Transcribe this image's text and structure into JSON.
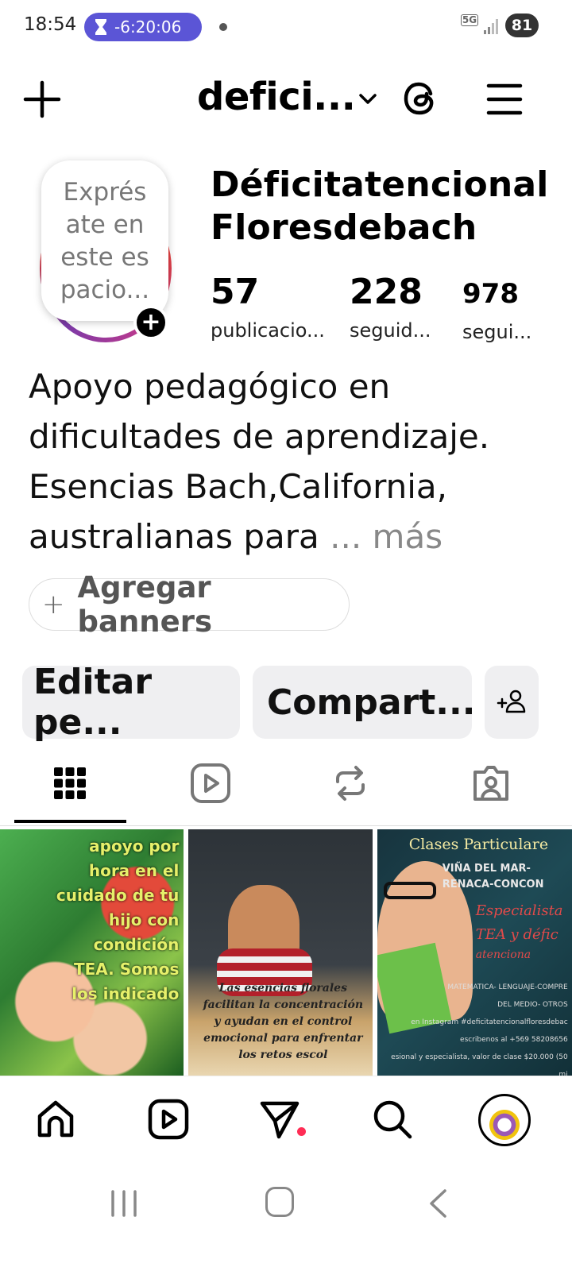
{
  "status_bar": {
    "time": "18:54",
    "timer": "-6:20:06",
    "network": "5G",
    "battery": "81"
  },
  "header": {
    "username": "defici...",
    "icons": [
      "plus-icon",
      "chevron-down-icon",
      "threads-icon",
      "menu-icon"
    ]
  },
  "profile": {
    "note_text": "Exprés ate en este es pacio...",
    "display_name_line1": "Déficitatencional",
    "display_name_line2": "Floresdebach",
    "stats": [
      {
        "value": "57",
        "label": "publicacio..."
      },
      {
        "value": "228",
        "label": "seguid..."
      },
      {
        "value": "978",
        "label": "segui..."
      }
    ],
    "bio": "Apoyo pedagógico en dificultades de aprendizaje. Esencias  Bach,California, australianas para ",
    "bio_more": "... más"
  },
  "actions": {
    "add_banners": "Agregar banners",
    "edit_profile": "Editar pe...",
    "share_profile": "Compart..."
  },
  "tabs": [
    "grid-icon",
    "reels-icon",
    "reposts-icon",
    "tagged-icon"
  ],
  "posts": [
    {
      "text": "apoyo por hora en el cuidado de tu hijo con condición TEA. Somos los indicado"
    },
    {
      "text": "Las esencias florales facilitan la concentración y ayudan en el control emocional para enfrentar los retos escol"
    },
    {
      "title": "Clases Particulare",
      "sub1": "VIÑA DEL MAR-",
      "sub2": "RENACA-CONCON",
      "spec1": "Especialista",
      "spec2": "TEA y défic",
      "spec3": "atenciona",
      "line1": "MATEMATICA- LENGUAJE-COMPRE",
      "line2": "DEL MEDIO- OTROS",
      "line3": "en Instagram #deficitatencionalfloresdebac",
      "line4": "escribenos al +569 58208656",
      "line5": "esional y especialista, valor de clase $20.000 (50 mi"
    }
  ],
  "colors": {
    "timer_bg": "#5b55d6",
    "notification_dot": "#ff2d55",
    "button_bg": "#efeff1"
  }
}
